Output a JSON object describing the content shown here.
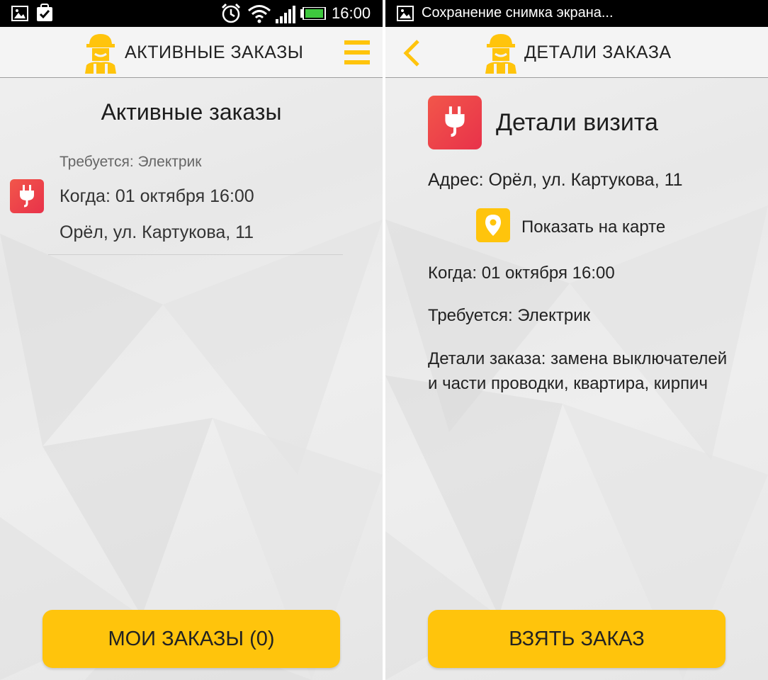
{
  "colors": {
    "accent": "#ffc40c",
    "badge": "#e8324a",
    "statusbar": "#000000"
  },
  "left_screen": {
    "status_bar": {
      "time": "16:00",
      "icons": [
        "gallery-icon",
        "task-icon",
        "alarm-icon",
        "wifi-icon",
        "signal-icon",
        "battery-icon"
      ]
    },
    "app_bar": {
      "title": "АКТИВНЫЕ ЗАКАЗЫ",
      "logo": "worker-logo-icon",
      "menu_icon": "hamburger-menu-icon"
    },
    "heading": "Активные заказы",
    "orders": [
      {
        "icon": "plug-icon",
        "required": "Требуется: Электрик",
        "when": "Когда: 01 октября 16:00",
        "address": "Орёл, ул. Картукова, 11"
      }
    ],
    "bottom_button": "МОИ ЗАКАЗЫ (0)"
  },
  "right_screen": {
    "status_bar": {
      "notification": "Сохранение снимка экрана...",
      "icons": [
        "gallery-icon"
      ]
    },
    "app_bar": {
      "title": "ДЕТАЛИ ЗАКАЗА",
      "logo": "worker-logo-icon",
      "back_icon": "chevron-left-icon"
    },
    "heading": "Детали визита",
    "address": "Адрес: Орёл, ул. Картукова, 11",
    "map_link": "Показать на карте",
    "when": "Когда: 01 октября 16:00",
    "required": "Требуется: Электрик",
    "details_line1": "Детали заказа: замена выключателей",
    "details_line2": "и части проводки, квартира, кирпич",
    "bottom_button": "ВЗЯТЬ ЗАКАЗ"
  }
}
